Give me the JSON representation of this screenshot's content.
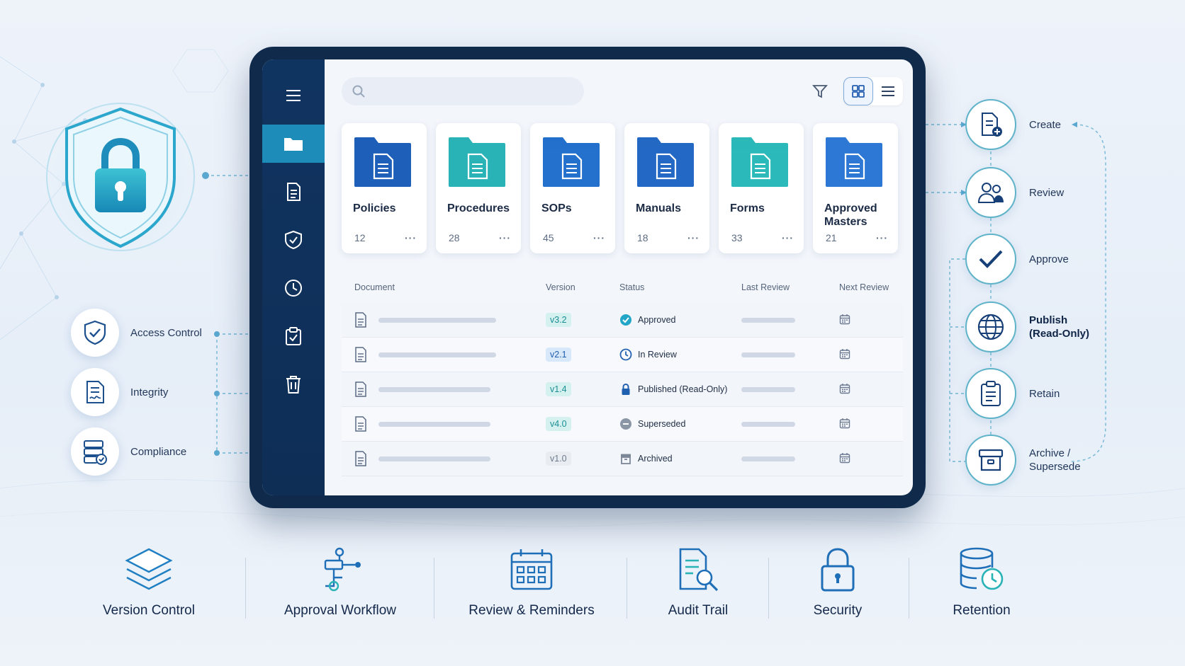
{
  "left_features": [
    {
      "label": "Access Control",
      "icon": "shield-check-icon"
    },
    {
      "label": "Integrity",
      "icon": "document-signature-icon"
    },
    {
      "label": "Compliance",
      "icon": "server-check-icon"
    }
  ],
  "sidebar": {
    "items": [
      {
        "icon": "menu-icon"
      },
      {
        "icon": "folder-icon",
        "active": true
      },
      {
        "icon": "document-icon"
      },
      {
        "icon": "shield-icon"
      },
      {
        "icon": "clock-icon"
      },
      {
        "icon": "clipboard-check-icon"
      },
      {
        "icon": "trash-icon"
      }
    ]
  },
  "search": {
    "placeholder": ""
  },
  "folders": [
    {
      "name": "Policies",
      "count": "12",
      "color": "#1d5fb8"
    },
    {
      "name": "Procedures",
      "count": "28",
      "color": "#2ab3b6"
    },
    {
      "name": "SOPs",
      "count": "45",
      "color": "#2370cc"
    },
    {
      "name": "Manuals",
      "count": "18",
      "color": "#2369c4"
    },
    {
      "name": "Forms",
      "count": "33",
      "color": "#2bb8b9"
    },
    {
      "name": "Approved Masters",
      "count": "21",
      "color": "#2d78d4"
    }
  ],
  "table": {
    "headers": {
      "document": "Document",
      "version": "Version",
      "status": "Status",
      "last_review": "Last Review",
      "next_review": "Next Review"
    },
    "rows": [
      {
        "version": "v3.2",
        "status": "Approved",
        "status_icon": "check-circle-icon"
      },
      {
        "version": "v2.1",
        "status": "In Review",
        "status_icon": "clock-icon"
      },
      {
        "version": "v1.4",
        "status": "Published (Read-Only)",
        "status_icon": "lock-icon"
      },
      {
        "version": "v4.0",
        "status": "Superseded",
        "status_icon": "minus-circle-icon"
      },
      {
        "version": "v1.0",
        "status": "Archived",
        "status_icon": "archive-icon"
      }
    ]
  },
  "lifecycle": [
    {
      "label": "Create",
      "icon": "document-add-icon"
    },
    {
      "label": "Review",
      "icon": "users-icon"
    },
    {
      "label": "Approve",
      "icon": "checkmark-icon"
    },
    {
      "label": "Publish (Read-Only)",
      "icon": "globe-icon"
    },
    {
      "label": "Retain",
      "icon": "clipboard-icon"
    },
    {
      "label": "Archive / Supersede",
      "icon": "archive-box-icon"
    }
  ],
  "bottom_features": [
    {
      "label": "Version Control",
      "icon": "layers-icon"
    },
    {
      "label": "Approval Workflow",
      "icon": "workflow-icon"
    },
    {
      "label": "Review & Reminders",
      "icon": "calendar-icon"
    },
    {
      "label": "Audit Trail",
      "icon": "document-search-icon"
    },
    {
      "label": "Security",
      "icon": "padlock-icon"
    },
    {
      "label": "Retention",
      "icon": "database-clock-icon"
    }
  ],
  "colors": {
    "navy": "#0f2a4a",
    "accent": "#1d8cb8",
    "teal": "#2ab3b6",
    "blue": "#1d5fb8"
  }
}
